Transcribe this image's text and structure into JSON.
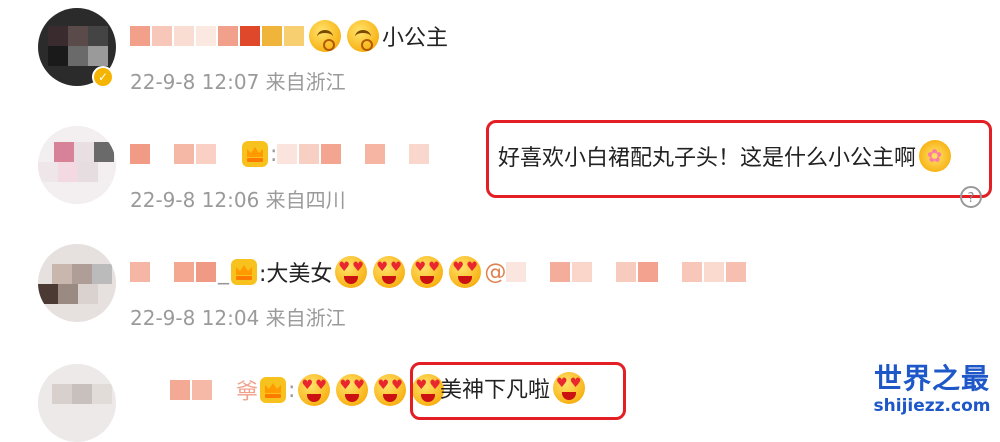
{
  "comments": [
    {
      "text": "小公主",
      "meta": "22-9-8 12:07 来自浙江"
    },
    {
      "text": "好喜欢小白裙配丸子头！这是什么小公主啊",
      "meta": "22-9-8 12:06 来自四川"
    },
    {
      "text": ":大美女",
      "meta": "22-9-8 12:04 来自浙江"
    },
    {
      "text": "美神下凡啦",
      "meta": ""
    }
  ],
  "watermark": {
    "title": "世界之最",
    "url": "shijiezz.com"
  },
  "colors": {
    "highlight_border": "#e31e24",
    "meta_text": "#9a9a9a",
    "watermark": "#1d57c8"
  }
}
